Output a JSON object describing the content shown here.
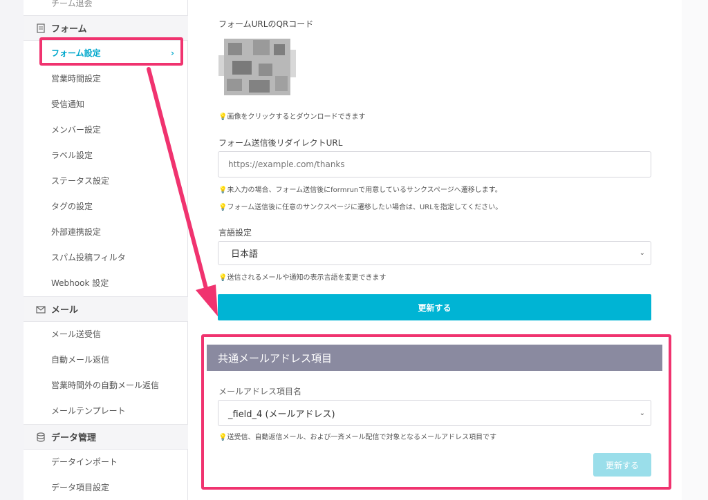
{
  "sidebar": {
    "top_item": "チーム退会",
    "sections": [
      {
        "title": "フォーム",
        "icon": "document-icon"
      },
      {
        "title": "メール",
        "icon": "mail-icon"
      },
      {
        "title": "データ管理",
        "icon": "database-icon"
      }
    ],
    "form_items": [
      "フォーム設定",
      "営業時間設定",
      "受信通知",
      "メンバー設定",
      "ラベル設定",
      "ステータス設定",
      "タグの設定",
      "外部連携設定",
      "スパム投稿フィルタ",
      "Webhook 設定"
    ],
    "mail_items": [
      "メール送受信",
      "自動メール返信",
      "営業時間外の自動メール返信",
      "メールテンプレート"
    ],
    "data_items": [
      "データインポート",
      "データ項目設定"
    ],
    "active_chevron": "›"
  },
  "main": {
    "qr_label": "フォームURLのQRコード",
    "qr_hint": "画像をクリックするとダウンロードできます",
    "redirect_label": "フォーム送信後リダイレクトURL",
    "redirect_placeholder": "https://example.com/thanks",
    "redirect_hint1": "未入力の場合、フォーム送信後にformrunで用意しているサンクスページへ遷移します。",
    "redirect_hint2": "フォーム送信後に任意のサンクスページに遷移したい場合は、URLを指定してください。",
    "lang_label": "言語設定",
    "lang_value": "日本語",
    "lang_hint": "送信されるメールや通知の表示言語を変更できます",
    "update_button": "更新する",
    "panel_title": "共通メールアドレス項目",
    "email_field_label": "メールアドレス項目名",
    "email_field_value": "_field_4 (メールアドレス)",
    "email_hint": "送受信、自動返信メール、および一斉メール配信で対象となるメールアドレス項目です",
    "panel_update_button": "更新する"
  },
  "colors": {
    "accent": "#00b4d4",
    "highlight": "#f0336f",
    "panel_header": "#8a8aa0"
  }
}
